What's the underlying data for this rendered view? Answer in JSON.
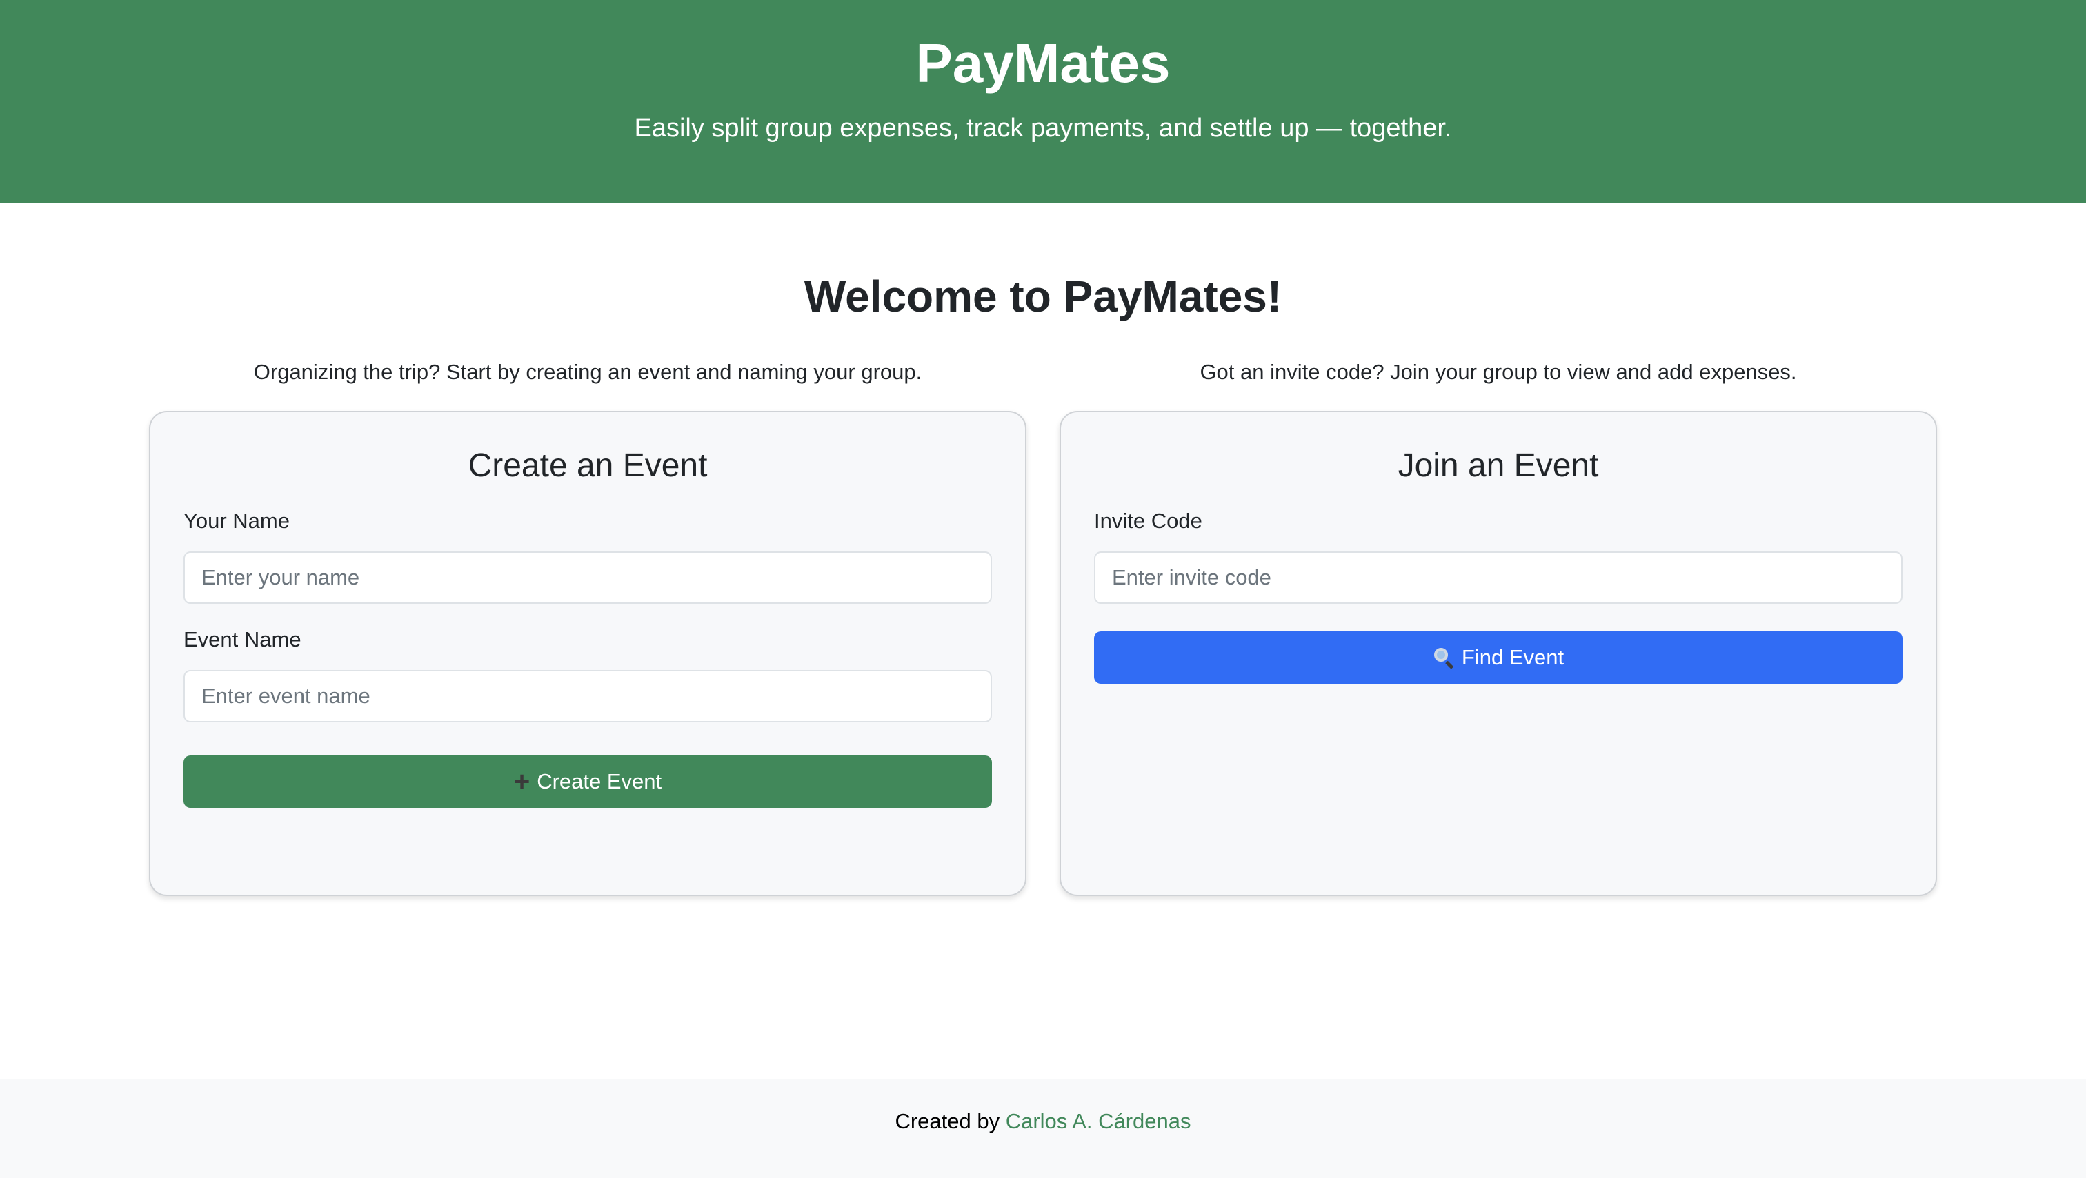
{
  "header": {
    "title": "PayMates",
    "subtitle": "Easily split group expenses, track payments, and settle up — together."
  },
  "main": {
    "welcome": "Welcome to PayMates!",
    "intro_create": "Organizing the trip? Start by creating an event and naming your group.",
    "intro_join": "Got an invite code? Join your group to view and add expenses."
  },
  "create_card": {
    "title": "Create an Event",
    "name_label": "Your Name",
    "name_placeholder": "Enter your name",
    "name_value": "",
    "event_label": "Event Name",
    "event_placeholder": "Enter event name",
    "event_value": "",
    "button_icon": "plus-icon",
    "button_label": "Create Event"
  },
  "join_card": {
    "title": "Join an Event",
    "code_label": "Invite Code",
    "code_placeholder": "Enter invite code",
    "code_value": "",
    "button_icon": "magnifying-glass-icon",
    "button_label": "Find Event"
  },
  "footer": {
    "prefix": "Created by ",
    "author_link": "Carlos A. Cárdenas"
  },
  "colors": {
    "brand_green": "#41885a",
    "primary_blue": "#316cf4",
    "card_bg": "#f7f8fa",
    "footer_bg": "#f8f9fa"
  }
}
